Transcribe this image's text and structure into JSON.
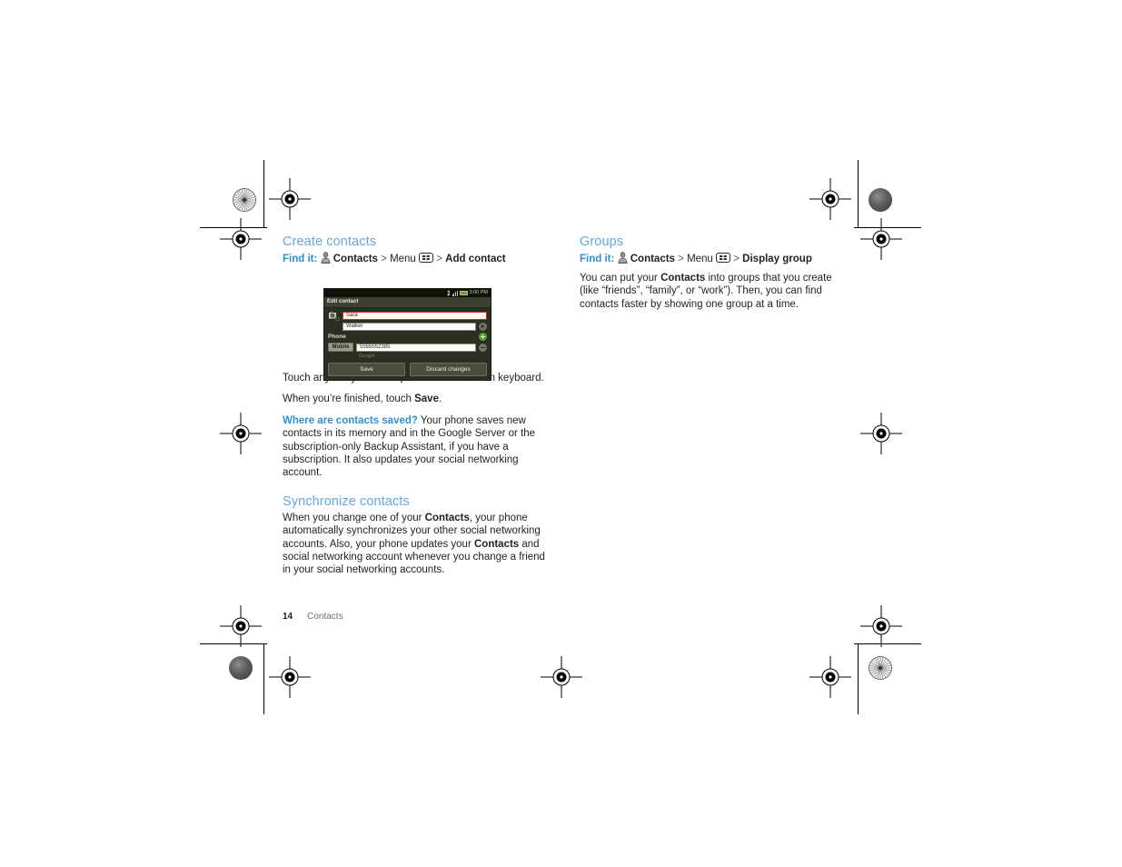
{
  "document": {
    "page_number": "14",
    "footer_section": "Contacts"
  },
  "colors": {
    "heading_blue": "#62a8dd",
    "accent_blue": "#2f8fd4",
    "body_text": "#231f20",
    "focus_red": "#d72a1f",
    "battery_green": "#6ca02e"
  },
  "left_column": {
    "create": {
      "heading": "Create contacts",
      "findit": {
        "label": "Find it:",
        "contacts": "Contacts",
        "sep1": ">",
        "menu": "Menu",
        "sep2": ">",
        "target": "Add contact"
      },
      "paragraphs": [
        "Touch any entry area to open the touchscreen keyboard."
      ],
      "finish_line": {
        "pre": "When you’re finished, touch ",
        "bold": "Save",
        "post": "."
      },
      "saved_note": {
        "highlight": "Where are contacts saved?",
        "text": " Your phone saves new contacts in its memory and in the Google Server or the subscription-only Backup Assistant, if you have a subscription. It also updates your social networking account."
      }
    },
    "synchronize": {
      "heading": "Synchronize contacts",
      "parts": {
        "p1": "When you change one of your ",
        "b1": "Contacts",
        "p2": ", your phone automatically synchronizes your other social networking accounts. Also, your phone updates your ",
        "b2": "Contacts",
        "p3": " and social networking account whenever you change a friend in your social networking accounts."
      }
    }
  },
  "right_column": {
    "groups": {
      "heading": "Groups",
      "findit": {
        "label": "Find it:",
        "contacts": "Contacts",
        "sep1": ">",
        "menu": "Menu",
        "sep2": ">",
        "target": "Display group"
      },
      "parts": {
        "p1": "You can put your ",
        "b1": "Contacts",
        "p2": " into groups that you create (like “friends”, “family”, or “work”). Then, you can find contacts faster by showing one group at a time."
      }
    }
  },
  "phone_screenshot": {
    "status_bar": {
      "time": "3:00 PM"
    },
    "title": "Edit contact",
    "first_name": "Sara",
    "last_name": "Walker",
    "phone_section_label": "Phone",
    "phone_type": "Mobile",
    "phone_number": "5555552385",
    "account_label": "Google",
    "save_button": "Save",
    "discard_button": "Discard changes"
  }
}
